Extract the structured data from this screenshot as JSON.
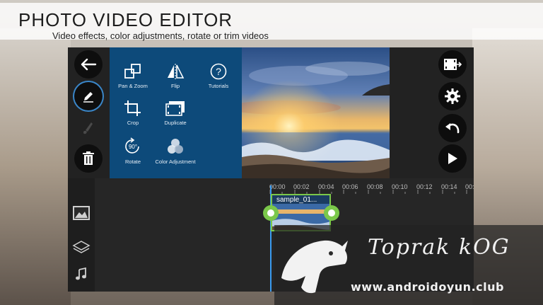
{
  "header": {
    "title": "PHOTO VIDEO EDITOR",
    "subtitle": "Video effects, color adjustments, rotate or trim videos"
  },
  "left_rail": [
    {
      "icon": "back-arrow-icon"
    },
    {
      "icon": "pencil-icon",
      "active": true
    },
    {
      "icon": "brush-icon",
      "disabled": true
    },
    {
      "icon": "trash-icon"
    }
  ],
  "menu": {
    "items": [
      {
        "label": "Pan & Zoom",
        "icon": "pan-zoom-icon"
      },
      {
        "label": "Flip",
        "icon": "flip-icon"
      },
      {
        "label": "Tutorials",
        "icon": "help-icon"
      },
      {
        "label": "Crop",
        "icon": "crop-icon"
      },
      {
        "label": "Duplicate",
        "icon": "duplicate-icon"
      },
      {
        "label": "Rotate",
        "icon": "rotate-icon",
        "badge": "90°"
      },
      {
        "label": "Color Adjustment",
        "icon": "color-adjustment-icon"
      }
    ]
  },
  "right_rail": [
    {
      "icon": "export-video-icon"
    },
    {
      "icon": "gear-icon"
    },
    {
      "icon": "undo-icon"
    },
    {
      "icon": "play-icon"
    }
  ],
  "timeline": {
    "ticks": [
      "00:00",
      "00:02",
      "00:04",
      "00:06",
      "00:08",
      "00:10",
      "00:12",
      "00:14",
      "00:"
    ],
    "clip_name": "sample_01...",
    "track_icons": [
      "image-track-icon",
      "layers-icon",
      "music-note-icon"
    ],
    "accent": "#7bc84a",
    "playhead_color": "#3a9bf0"
  },
  "watermark": {
    "name": "Toprak kOG",
    "url": "www.androidoyun.club"
  },
  "colors": {
    "menu_bg": "#0d4a7a",
    "app_bg": "#1f1f1f"
  }
}
